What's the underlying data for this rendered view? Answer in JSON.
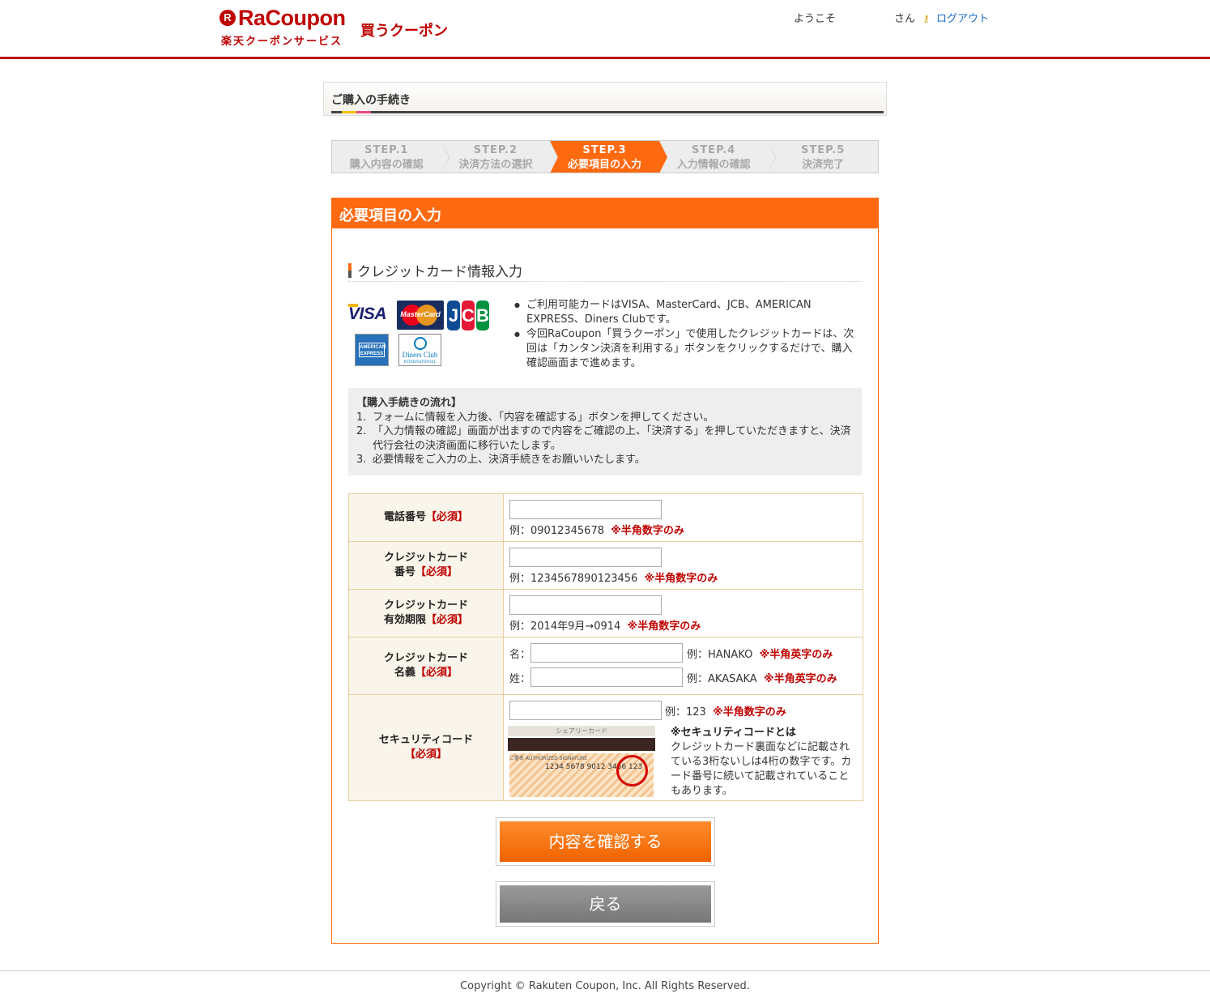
{
  "header": {
    "logo_letter": "R",
    "logo_text": "RaCoupon",
    "logo_sub": "楽天クーポンサービス",
    "logo_kau": "買うクーポン",
    "welcome": "ようこそ",
    "san": "さん",
    "logout": "ログアウト",
    "logout_icon": "key-icon"
  },
  "section_title": "ご購入の手続き",
  "steps": [
    {
      "num": "STEP.1",
      "label": "購入内容の確認",
      "active": false
    },
    {
      "num": "STEP.2",
      "label": "決済方法の選択",
      "active": false
    },
    {
      "num": "STEP.3",
      "label": "必要項目の入力",
      "active": true
    },
    {
      "num": "STEP.4",
      "label": "入力情報の確認",
      "active": false
    },
    {
      "num": "STEP.5",
      "label": "決済完了",
      "active": false
    }
  ],
  "panel": {
    "title": "必要項目の入力",
    "cc_title": "クレジットカード情報入力",
    "cards": {
      "visa": "VISA",
      "mastercard": "MasterCard",
      "jcb": [
        "J",
        "C",
        "B"
      ],
      "amex": "AMERICAN EXPRESS",
      "diners": "Diners Club",
      "diners_sub": "INTERNATIONAL"
    },
    "notes": [
      "ご利用可能カードはVISA、MasterCard、JCB、AMERICAN EXPRESS、Diners Clubです。",
      "今回RaCoupon「買うクーポン」で使用したクレジットカードは、次回は「カンタン決済を利用する」ボタンをクリックするだけで、購入確認画面まで進めます。"
    ],
    "flow": {
      "title": "【購入手続きの流れ】",
      "items": [
        {
          "num": "1.",
          "text": "フォームに情報を入力後、「内容を確認する」ボタンを押してください。"
        },
        {
          "num": "2.",
          "text": "「入力情報の確認」画面が出ますので内容をご確認の上、「決済する」を押していただきますと、決済代行会社の決済画面に移行いたします。"
        },
        {
          "num": "3.",
          "text": "必要情報をご入力の上、決済手続きをお願いいたします。"
        }
      ]
    }
  },
  "form": {
    "required": "【必須】",
    "phone": {
      "label": "電話番号",
      "value": "",
      "example": "例：09012345678",
      "note": "※半角数字のみ"
    },
    "card_number": {
      "label1": "クレジットカード",
      "label2": "番号",
      "value": "",
      "example": "例：1234567890123456",
      "note": "※半角数字のみ"
    },
    "expiry": {
      "label1": "クレジットカード",
      "label2": "有効期限",
      "value": "",
      "example": "例：2014年9月→0914",
      "note": "※半角数字のみ"
    },
    "holder": {
      "label1": "クレジットカード",
      "label2": "名義",
      "first_label": "名：",
      "first_value": "",
      "first_example": "例：HANAKO",
      "first_note": "※半角英字のみ",
      "last_label": "姓：",
      "last_value": "",
      "last_example": "例：AKASAKA",
      "last_note": "※半角英字のみ"
    },
    "security": {
      "label": "セキュリティコード",
      "value": "",
      "example": "例：123",
      "note": "※半角数字のみ",
      "card_header": "シェアリーカード",
      "card_sig_label": "ご署名 AUTHORIZED SIGNATURE",
      "card_numbers": "1234 5678 9012 3456 123",
      "desc_title": "※セキュリティコードとは",
      "desc": "クレジットカード裏面などに記載されている3桁ないしは4桁の数字です。カード番号に続いて記載されていることもあります。"
    }
  },
  "buttons": {
    "confirm": "内容を確認する",
    "back": "戻る"
  },
  "footer": "Copyright © Rakuten Coupon, Inc. All Rights Reserved.",
  "colors": {
    "brand": "#bf0000",
    "accent": "#ff6a10",
    "link": "#1a6dc9"
  }
}
